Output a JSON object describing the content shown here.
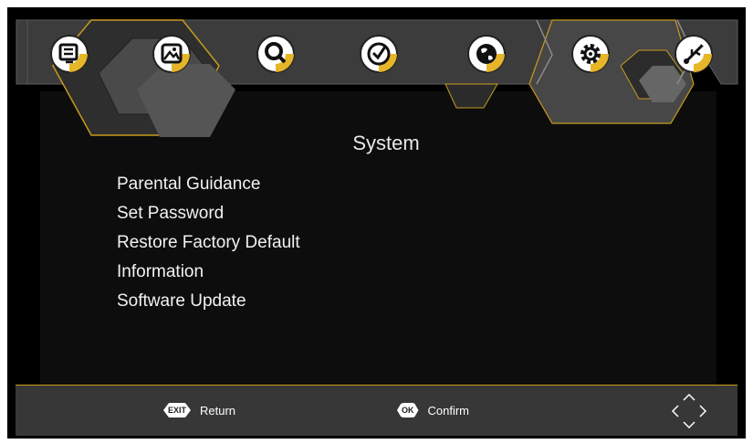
{
  "top_nav": {
    "icons": [
      {
        "name": "tv-program-icon"
      },
      {
        "name": "picture-icon"
      },
      {
        "name": "channel-search-icon"
      },
      {
        "name": "time-clock-icon"
      },
      {
        "name": "globe-language-icon"
      },
      {
        "name": "system-gear-icon",
        "selected": true
      },
      {
        "name": "usb-icon"
      }
    ],
    "accent_color": "#e6b628"
  },
  "main": {
    "title": "System",
    "menu_items": [
      {
        "label": "Parental Guidance"
      },
      {
        "label": "Set Password"
      },
      {
        "label": "Restore Factory Default"
      },
      {
        "label": "Information"
      },
      {
        "label": "Software Update"
      }
    ]
  },
  "footer": {
    "exit_key": "EXIT",
    "exit_label": "Return",
    "ok_key": "OK",
    "ok_label": "Confirm"
  }
}
